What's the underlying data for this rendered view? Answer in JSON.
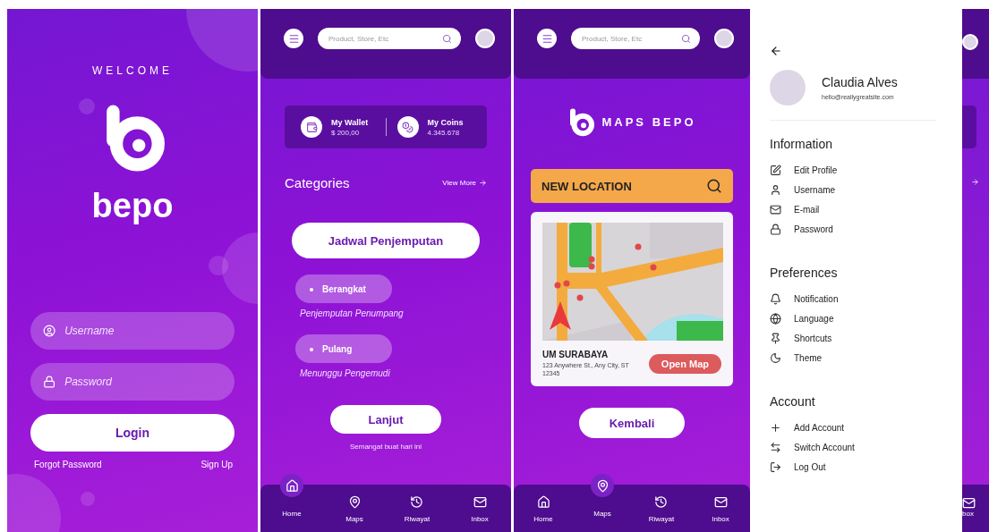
{
  "login_screen": {
    "welcome": "WELCOME",
    "logo_text": "bepo",
    "fields": [
      {
        "kind": "user",
        "placeholder": "Username"
      },
      {
        "kind": "lock",
        "placeholder": "Password"
      }
    ],
    "login_button": "Login",
    "forgot_link": "Forgot Password",
    "signup_link": "Sign Up"
  },
  "home_screen": {
    "search": {
      "placeholder": "Product, Store, Etc"
    },
    "balances": [
      {
        "kind": "wallet",
        "label": "My Wallet",
        "value": "$ 200,00"
      },
      {
        "kind": "coins",
        "label": "My Coins",
        "value": "4.345.678"
      }
    ],
    "categories_title": "Categories",
    "view_more": "View More",
    "schedule_button": "Jadwal Penjemputan",
    "options": [
      {
        "label": "Berangkat",
        "caption": "Penjemputan Penumpang"
      },
      {
        "label": "Pulang",
        "caption": "Menunggu Pengemudi"
      }
    ],
    "next_button": "Lanjut",
    "motto": "Semangat buat hari ini",
    "nav": [
      {
        "kind": "home",
        "label": "Home",
        "selected": true
      },
      {
        "kind": "maps",
        "label": "Maps",
        "selected": false
      },
      {
        "kind": "history",
        "label": "Riwayat",
        "selected": false
      },
      {
        "kind": "inbox",
        "label": "Inbox",
        "selected": false
      }
    ]
  },
  "maps_screen": {
    "search": {
      "placeholder": "Product, Store, Etc"
    },
    "brand": "MAPS BEPO",
    "new_location": "NEW LOCATION",
    "place": {
      "name": "UM SURABAYA",
      "address": "123 Anywhere St., Any City, ST 12345"
    },
    "open_map_button": "Open Map",
    "back_button": "Kembali",
    "nav": [
      {
        "kind": "home",
        "label": "Home",
        "selected": false
      },
      {
        "kind": "maps",
        "label": "Maps",
        "selected": true
      },
      {
        "kind": "history",
        "label": "Riwayat",
        "selected": false
      },
      {
        "kind": "inbox",
        "label": "Inbox",
        "selected": false
      }
    ]
  },
  "profile_drawer": {
    "name": "Claudia Alves",
    "email": "hello@reallygreatsite.com",
    "sections": [
      {
        "title": "Information",
        "items": [
          {
            "kind": "edit",
            "label": "Edit Profile"
          },
          {
            "kind": "user",
            "label": "Username"
          },
          {
            "kind": "mail",
            "label": "E-mail"
          },
          {
            "kind": "lock",
            "label": "Password"
          }
        ]
      },
      {
        "title": "Preferences",
        "items": [
          {
            "kind": "bell",
            "label": "Notification"
          },
          {
            "kind": "globe",
            "label": "Language"
          },
          {
            "kind": "pin",
            "label": "Shortcuts"
          },
          {
            "kind": "moon",
            "label": "Theme"
          }
        ]
      },
      {
        "title": "Account",
        "items": [
          {
            "kind": "plus",
            "label": "Add Account"
          },
          {
            "kind": "switch",
            "label": "Switch Account"
          },
          {
            "kind": "logout",
            "label": "Log Out"
          }
        ]
      }
    ]
  },
  "peek_screen": {
    "nav_label": "box"
  }
}
